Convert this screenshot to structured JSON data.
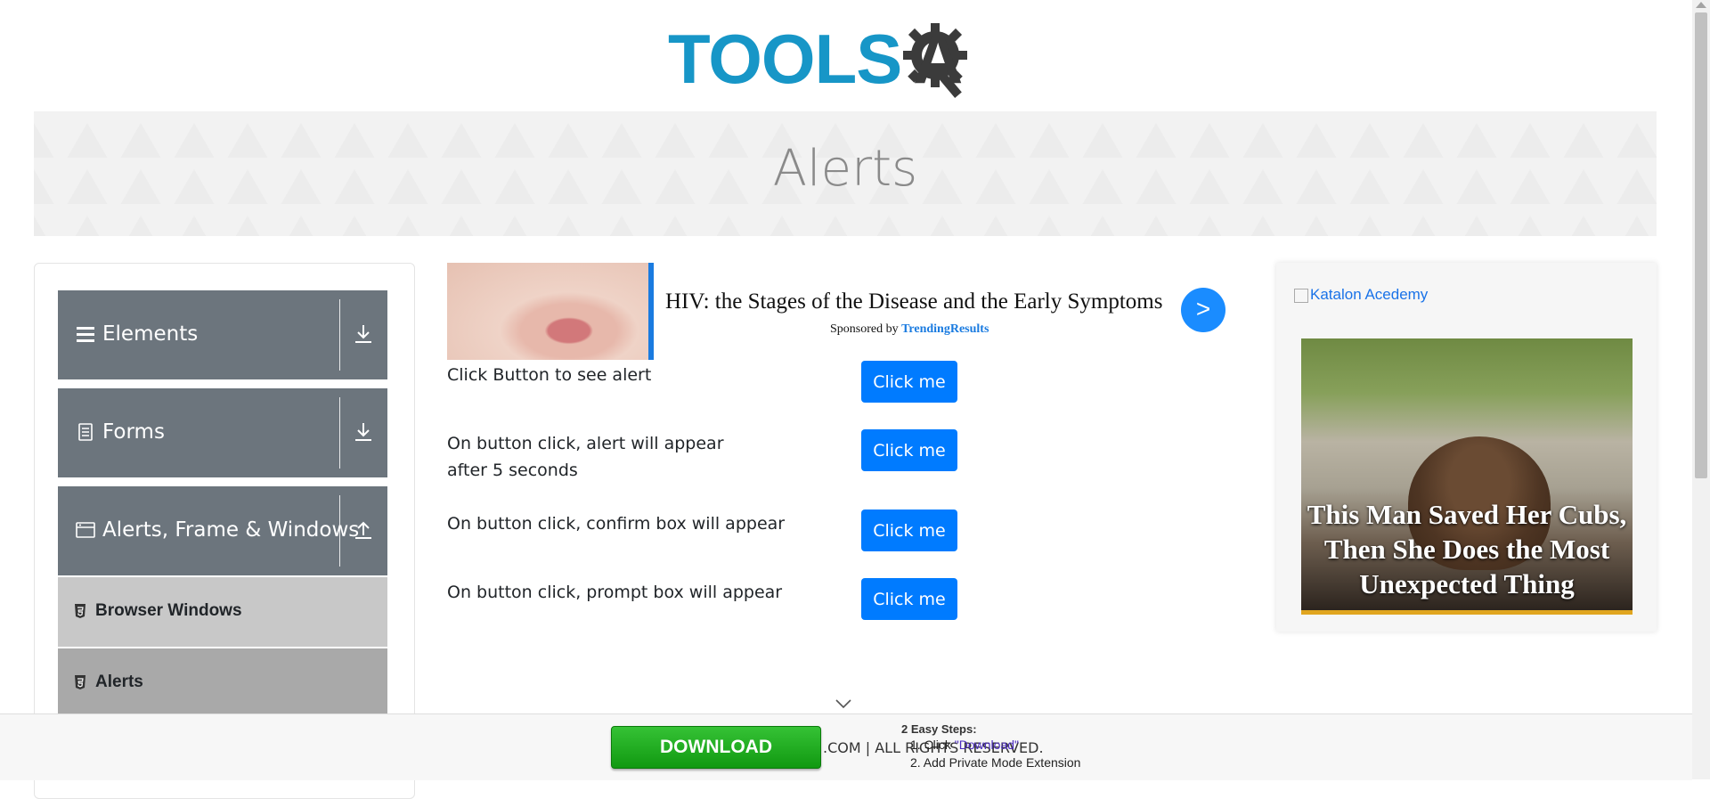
{
  "logo": {
    "text_left": "TOOLS",
    "text_right": "A",
    "alt": "TOOLSQA"
  },
  "banner": {
    "title": "Alerts"
  },
  "sidebar": {
    "groups": [
      {
        "label": "Elements",
        "icon": "menu-icon",
        "state": "collapsed"
      },
      {
        "label": "Forms",
        "icon": "form-icon",
        "state": "collapsed"
      },
      {
        "label": "Alerts, Frame & Windows",
        "icon": "window-icon",
        "state": "expanded"
      }
    ],
    "items": [
      {
        "label": "Browser Windows",
        "active": false
      },
      {
        "label": "Alerts",
        "active": true
      }
    ]
  },
  "ad": {
    "title": "HIV: the Stages of the Disease and the Early Symptoms",
    "sponsored_prefix": "Sponsored by",
    "sponsor": "TrendingResults",
    "next": ">"
  },
  "rows": [
    {
      "text": "Click Button to see alert",
      "button": "Click me"
    },
    {
      "text": "On button click, alert will appear after 5 seconds",
      "button": "Click me"
    },
    {
      "text": "On button click, confirm box will appear",
      "button": "Click me"
    },
    {
      "text": "On button click, prompt box will appear",
      "button": "Click me"
    }
  ],
  "right_ad": {
    "link_alt": "Katalon Acedemy",
    "caption": "This Man Saved Her Cubs, Then She Does the Most Unexpected Thing"
  },
  "footer": {
    "copyright": ".COM | ALL RIGHTS RESERVED.",
    "download": "DOWNLOAD",
    "steps_title": "2 Easy Steps:",
    "step1_prefix": "1. Click ",
    "step1_link": "\"Download\"",
    "step2": "2. Add Private Mode Extension"
  },
  "colors": {
    "primary": "#007bff",
    "sidebar_group": "#6c757d",
    "logo_blue": "#1796c7",
    "download_green": "#1aaa1a"
  }
}
